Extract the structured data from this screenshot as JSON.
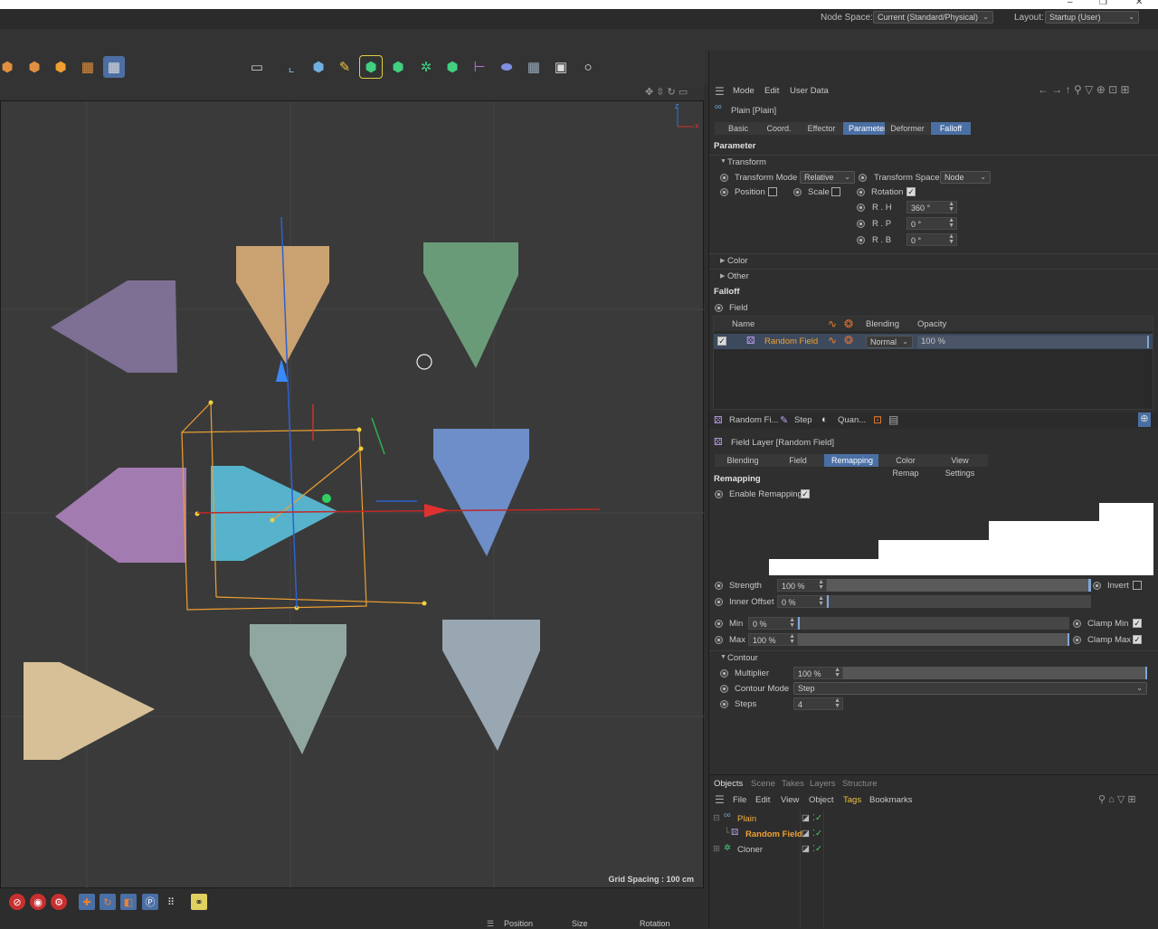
{
  "window": {
    "minimize": "–",
    "maximize": "❐",
    "close": "✕"
  },
  "menubar": {
    "node_space_label": "Node Space:",
    "node_space_value": "Current (Standard/Physical)",
    "layout_label": "Layout:",
    "layout_value": "Startup (User)"
  },
  "viewport": {
    "grid_spacing": "Grid Spacing : 100 cm",
    "axis_z": "z",
    "axis_x": "x"
  },
  "coord_bar": {
    "position": "Position",
    "size": "Size",
    "rotation": "Rotation"
  },
  "attributes": {
    "menu": [
      "Mode",
      "Edit",
      "User Data"
    ],
    "object_title": "Plain [Plain]",
    "tabs": [
      "Basic",
      "Coord.",
      "Effector",
      "Parameter",
      "Deformer",
      "Falloff"
    ],
    "active_tabs": [
      "Parameter",
      "Falloff"
    ],
    "parameter_header": "Parameter",
    "transform_group": "Transform",
    "transform_mode_label": "Transform Mode",
    "transform_mode_value": "Relative",
    "transform_space_label": "Transform Space",
    "transform_space_value": "Node",
    "position_label": "Position",
    "scale_label": "Scale",
    "rotation_label": "Rotation",
    "rh_label": "R . H",
    "rh_value": "360 °",
    "rp_label": "R . P",
    "rp_value": "0 °",
    "rb_label": "R . B",
    "rb_value": "0 °",
    "color_group": "Color",
    "other_group": "Other",
    "falloff_header": "Falloff",
    "field_label": "Field",
    "field_list_headers": {
      "name": "Name",
      "blending": "Blending",
      "opacity": "Opacity"
    },
    "field_row": {
      "name": "Random Field",
      "blending": "Normal",
      "opacity": "100 %"
    },
    "layer_tabs": [
      "Random Fi...",
      "Step",
      "Quan..."
    ],
    "field_layer_title": "Field Layer [Random Field]",
    "layer_subtabs": [
      "Blending",
      "Field",
      "Remapping",
      "Color Remap",
      "View Settings"
    ],
    "active_subtab": "Remapping",
    "remapping_header": "Remapping",
    "enable_remapping_label": "Enable Remapping",
    "strength_label": "Strength",
    "strength_value": "100 %",
    "strength_level": 1.0,
    "invert_label": "Invert",
    "inner_offset_label": "Inner Offset",
    "inner_offset_value": "0 %",
    "min_label": "Min",
    "min_value": "0 %",
    "max_label": "Max",
    "max_value": "100 %",
    "clamp_min_label": "Clamp Min",
    "clamp_max_label": "Clamp Max",
    "contour_group": "Contour",
    "multiplier_label": "Multiplier",
    "multiplier_value": "100 %",
    "contour_mode_label": "Contour Mode",
    "contour_mode_value": "Step",
    "steps_label": "Steps",
    "steps_value": "4"
  },
  "objects_panel": {
    "tabs": [
      "Objects",
      "Scene",
      "Takes",
      "Layers",
      "Structure"
    ],
    "menu": [
      "File",
      "Edit",
      "View",
      "Object",
      "Tags",
      "Bookmarks"
    ],
    "items": [
      {
        "name": "Plain",
        "color": "#f0b040"
      },
      {
        "name": "Random Field",
        "color": "#f0a030"
      },
      {
        "name": "Cloner",
        "color": "#c8c8c8"
      }
    ]
  },
  "colors": {
    "accent": "#4a6fa5",
    "selection": "#f0a030",
    "bg": "#2f2f2f"
  }
}
